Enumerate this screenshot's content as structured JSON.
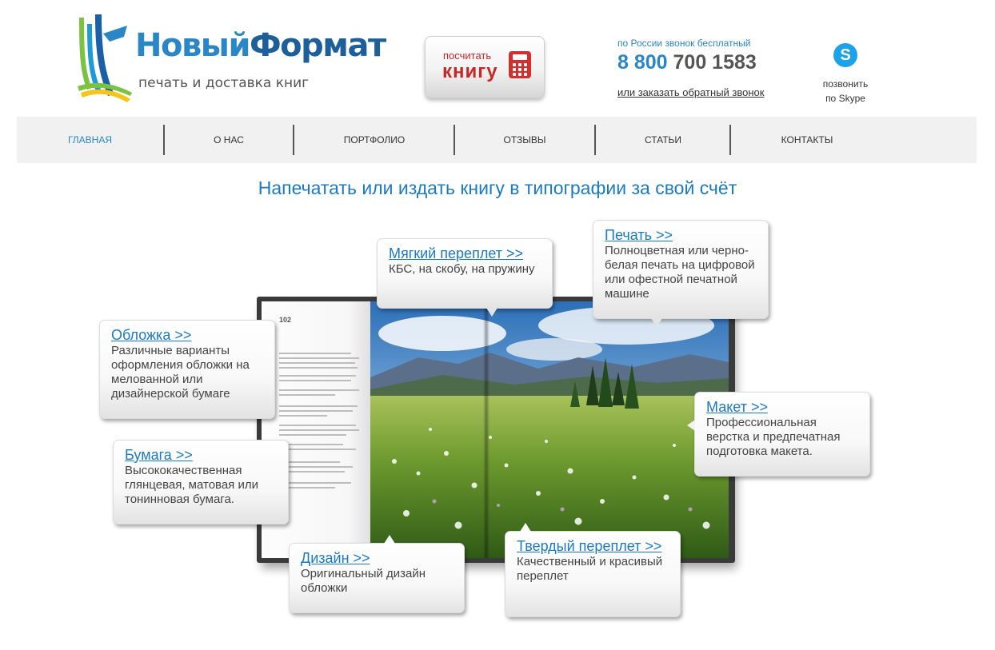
{
  "header": {
    "logo": {
      "name_part1": "Новый",
      "name_part2": "Формат",
      "tagline": "печать и доставка книг"
    },
    "calc_button": {
      "small": "посчитать",
      "big": "книгу"
    },
    "phone": {
      "note": "по России звонок бесплатный",
      "prefix": "8 800",
      "number": "700 1583",
      "callback": "или заказать обратный звонок"
    },
    "skype": {
      "line1": "позвонить",
      "line2": "по Skype"
    }
  },
  "nav": {
    "items": [
      "ГЛАВНАЯ",
      "О НАС",
      "ПОРТФОЛИО",
      "ОТЗЫВЫ",
      "СТАТЬИ",
      "КОНТАКТЫ"
    ],
    "active": "ГЛАВНАЯ"
  },
  "main": {
    "title": "Напечатать или издать книгу в типографии за свой счёт",
    "book_page_number": "102",
    "callouts": {
      "soft_binding": {
        "title": "Мягкий переплет >>",
        "text": "КБС, на скобу, на пружину"
      },
      "printing": {
        "title": "Печать >>",
        "text": "Полноцветная или черно-белая печать на цифровой или офестной печатной машине"
      },
      "cover": {
        "title": "Обложка >>",
        "text": "Различные варианты оформления обложки на мелованной или дизайнерской бумаге"
      },
      "layout": {
        "title": "Макет >>",
        "text": "Профессиональная верстка и предпечатная подготовка макета."
      },
      "paper": {
        "title": "Бумага >>",
        "text": "Высококачественная глянцевая, матовая или тонинновая бумага."
      },
      "design": {
        "title": "Дизайн >>",
        "text": "Оригинальный дизайн обложки"
      },
      "hard_binding": {
        "title": "Твердый переплет >>",
        "text": "Качественный и красивый переплет"
      }
    }
  },
  "colors": {
    "brand_blue": "#2a86c6",
    "link_blue": "#1b7ac4",
    "nav_bg": "#f1f1f1",
    "calc_red": "#c62828"
  }
}
